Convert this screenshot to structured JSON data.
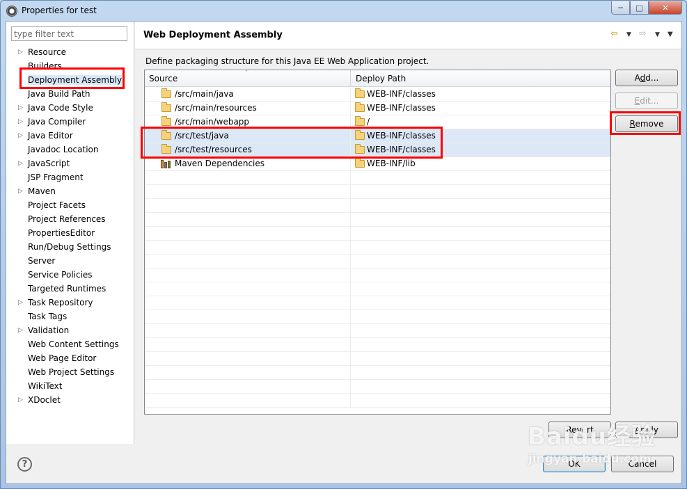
{
  "window": {
    "title": "Properties for test",
    "min": "─",
    "max": "□",
    "close": "✕"
  },
  "filter": {
    "placeholder": "type filter text"
  },
  "nav": [
    {
      "label": "Resource",
      "twisty": "▷"
    },
    {
      "label": "Builders",
      "twisty": ""
    },
    {
      "label": "Deployment Assembly",
      "twisty": "",
      "selected": true
    },
    {
      "label": "Java Build Path",
      "twisty": ""
    },
    {
      "label": "Java Code Style",
      "twisty": "▷"
    },
    {
      "label": "Java Compiler",
      "twisty": "▷"
    },
    {
      "label": "Java Editor",
      "twisty": "▷"
    },
    {
      "label": "Javadoc Location",
      "twisty": ""
    },
    {
      "label": "JavaScript",
      "twisty": "▷"
    },
    {
      "label": "JSP Fragment",
      "twisty": ""
    },
    {
      "label": "Maven",
      "twisty": "▷"
    },
    {
      "label": "Project Facets",
      "twisty": ""
    },
    {
      "label": "Project References",
      "twisty": ""
    },
    {
      "label": "PropertiesEditor",
      "twisty": ""
    },
    {
      "label": "Run/Debug Settings",
      "twisty": ""
    },
    {
      "label": "Server",
      "twisty": ""
    },
    {
      "label": "Service Policies",
      "twisty": ""
    },
    {
      "label": "Targeted Runtimes",
      "twisty": ""
    },
    {
      "label": "Task Repository",
      "twisty": "▷"
    },
    {
      "label": "Task Tags",
      "twisty": ""
    },
    {
      "label": "Validation",
      "twisty": "▷"
    },
    {
      "label": "Web Content Settings",
      "twisty": ""
    },
    {
      "label": "Web Page Editor",
      "twisty": ""
    },
    {
      "label": "Web Project Settings",
      "twisty": ""
    },
    {
      "label": "WikiText",
      "twisty": ""
    },
    {
      "label": "XDoclet",
      "twisty": "▷"
    }
  ],
  "page": {
    "title": "Web Deployment Assembly",
    "description": "Define packaging structure for this Java EE Web Application project.",
    "back_glyph": "⇦",
    "forward_glyph": "⇨",
    "dropdown_glyph": "▼"
  },
  "table": {
    "columns": {
      "source": "Source",
      "deploy_path": "Deploy Path",
      "sort_glyph": "˄"
    },
    "rows": [
      {
        "source": "/src/main/java",
        "deploy_path": "WEB-INF/classes",
        "icon": "folder-icon",
        "highlighted": false
      },
      {
        "source": "/src/main/resources",
        "deploy_path": "WEB-INF/classes",
        "icon": "folder-icon",
        "highlighted": false
      },
      {
        "source": "/src/main/webapp",
        "deploy_path": "/",
        "icon": "folder-icon",
        "highlighted": false
      },
      {
        "source": "/src/test/java",
        "deploy_path": "WEB-INF/classes",
        "icon": "folder-icon",
        "highlighted": true
      },
      {
        "source": "/src/test/resources",
        "deploy_path": "WEB-INF/classes",
        "icon": "folder-icon",
        "highlighted": true
      },
      {
        "source": "Maven Dependencies",
        "deploy_path": "WEB-INF/lib",
        "icon": "library-icon",
        "highlighted": false
      }
    ],
    "empty_rows": 17
  },
  "buttons": {
    "add": {
      "pre": "A",
      "ul": "d",
      "post": "d..."
    },
    "edit": {
      "pre": "",
      "ul": "E",
      "post": "dit..."
    },
    "remove": {
      "pre": "",
      "ul": "R",
      "post": "emove"
    },
    "revert": {
      "pre": "Re",
      "ul": "v",
      "post": "ert"
    },
    "apply": {
      "pre": "",
      "ul": "A",
      "post": "pply"
    },
    "ok": "OK",
    "cancel": "Cancel",
    "help": "?"
  },
  "watermark": {
    "line1": "Baidu经验",
    "line2": "jingyan.baidu.com"
  },
  "colors": {
    "highlight_box": "#ff0000",
    "selected_row": "#dce8f6"
  }
}
